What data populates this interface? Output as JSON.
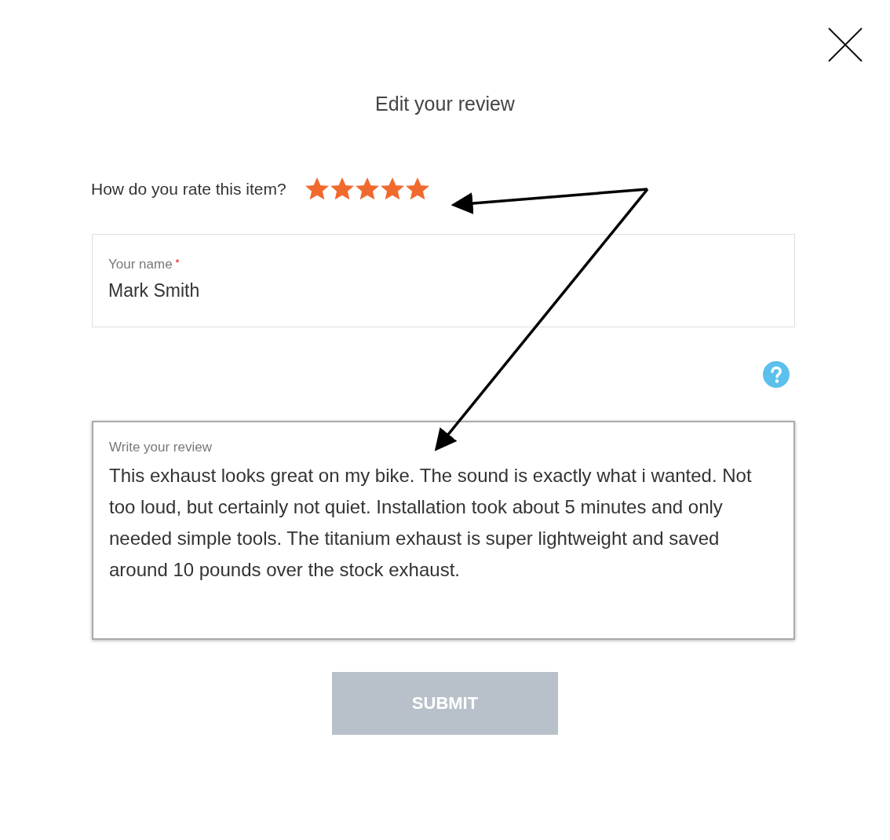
{
  "dialog": {
    "title": "Edit your review"
  },
  "rating": {
    "label": "How do you rate this item?",
    "stars": 5
  },
  "name_field": {
    "label": "Your name",
    "required_mark": "*",
    "value": "Mark Smith"
  },
  "review_field": {
    "label": "Write your review",
    "value": "This exhaust looks great on my bike. The sound is exactly what i wanted. Not too loud, but certainly not quiet. Installation took about 5 minutes and only needed simple tools. The titanium exhaust is super lightweight and saved around 10 pounds over the stock exhaust."
  },
  "submit_button": {
    "label": "SUBMIT",
    "disabled": true
  }
}
